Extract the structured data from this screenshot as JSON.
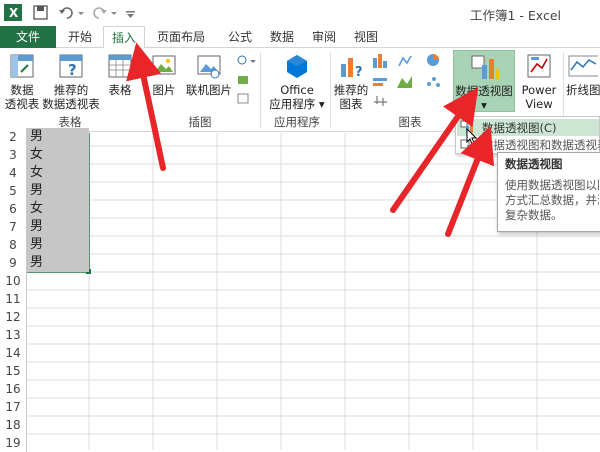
{
  "window": {
    "title": "工作簿1 - Excel"
  },
  "menus": [
    "文件",
    "开始",
    "插入",
    "页面布局",
    "公式",
    "数据",
    "审阅",
    "视图"
  ],
  "ribbon": {
    "pivot_table": "数据\n透视表",
    "recommended_pivot": "推荐的\n数据透视表",
    "table": "表格",
    "picture": "图片",
    "online_picture": "联机图片",
    "office_apps": "Office\n应用程序 ▾",
    "recommended_charts": "推荐的\n图表",
    "pivot_chart": "数据透视图\n▾",
    "power_view": "Power\nView",
    "line": "折线图",
    "groups": {
      "tables": "表格",
      "illustrations": "插图",
      "apps": "应用程序",
      "charts": "图表"
    }
  },
  "dropdown": {
    "item1": "数据透视图(C)",
    "item2": "数据透视图和数据透视表"
  },
  "tooltip": {
    "title": "数据透视图",
    "body": "使用数据透视图以图\n方式汇总数据，并浏\n复杂数据。"
  },
  "sheet": {
    "rows": [
      {
        "n": "2",
        "v": "男"
      },
      {
        "n": "3",
        "v": "女"
      },
      {
        "n": "4",
        "v": "女"
      },
      {
        "n": "5",
        "v": "男"
      },
      {
        "n": "6",
        "v": "女"
      },
      {
        "n": "7",
        "v": "男"
      },
      {
        "n": "8",
        "v": "男"
      },
      {
        "n": "9",
        "v": "男"
      },
      {
        "n": "10",
        "v": ""
      },
      {
        "n": "11",
        "v": ""
      },
      {
        "n": "12",
        "v": ""
      },
      {
        "n": "13",
        "v": ""
      },
      {
        "n": "14",
        "v": ""
      },
      {
        "n": "15",
        "v": ""
      },
      {
        "n": "16",
        "v": ""
      },
      {
        "n": "17",
        "v": ""
      },
      {
        "n": "18",
        "v": ""
      },
      {
        "n": "19",
        "v": ""
      }
    ]
  },
  "colors": {
    "excel_green": "#217346",
    "selection": "#c6c6c6",
    "highlight": "#a9d3b5",
    "arrow": "#e8262a"
  }
}
